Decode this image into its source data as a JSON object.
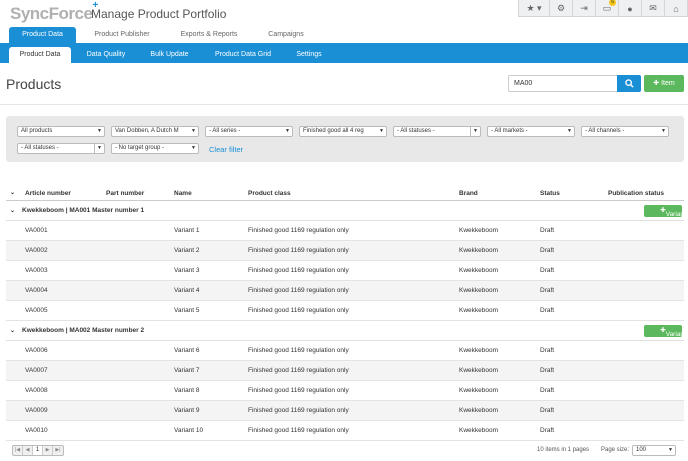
{
  "app": {
    "logo": "SyncForce",
    "logo_plus": "+",
    "title": "Manage Product Portfolio",
    "notification_count": "6"
  },
  "main_tabs": [
    {
      "label": "Product Data",
      "active": true
    },
    {
      "label": "Product Publisher"
    },
    {
      "label": "Exports & Reports"
    },
    {
      "label": "Campaigns"
    }
  ],
  "sub_tabs": [
    {
      "label": "Product Data",
      "active": true
    },
    {
      "label": "Data Quality"
    },
    {
      "label": "Bulk Update"
    },
    {
      "label": "Product Data Grid"
    },
    {
      "label": "Settings"
    }
  ],
  "page": {
    "title": "Products",
    "search_value": "MA00",
    "add_item_label": "Item"
  },
  "filters": {
    "row1": [
      "All products",
      "Van Dobben, A Dutch M",
      "- All series -",
      "Finished good all 4 reg",
      "- All statuses -",
      "- All markets -",
      "- All channels -"
    ],
    "row2": [
      "- All statuses -",
      "- No target group -"
    ],
    "clear_label": "Clear filter"
  },
  "grid": {
    "columns": [
      "Article number",
      "Part number",
      "Name",
      "Product class",
      "Brand",
      "Status",
      "Publication status"
    ],
    "add_variant_label": "Variant",
    "groups": [
      {
        "title": "Kwekkeboom | MA001 Master number 1",
        "rows": [
          {
            "article": "VA0001",
            "name": "Variant 1",
            "class": "Finished good 1169 regulation only",
            "brand": "Kwekkeboom",
            "status": "Draft"
          },
          {
            "article": "VA0002",
            "name": "Variant 2",
            "class": "Finished good 1169 regulation only",
            "brand": "Kwekkeboom",
            "status": "Draft"
          },
          {
            "article": "VA0003",
            "name": "Variant 3",
            "class": "Finished good 1169 regulation only",
            "brand": "Kwekkeboom",
            "status": "Draft"
          },
          {
            "article": "VA0004",
            "name": "Variant 4",
            "class": "Finished good 1169 regulation only",
            "brand": "Kwekkeboom",
            "status": "Draft"
          },
          {
            "article": "VA0005",
            "name": "Variant 5",
            "class": "Finished good 1169 regulation only",
            "brand": "Kwekkeboom",
            "status": "Draft"
          }
        ]
      },
      {
        "title": "Kwekkeboom | MA002 Master number 2",
        "rows": [
          {
            "article": "VA0006",
            "name": "Variant 6",
            "class": "Finished good 1169 regulation only",
            "brand": "Kwekkeboom",
            "status": "Draft"
          },
          {
            "article": "VA0007",
            "name": "Variant 7",
            "class": "Finished good 1169 regulation only",
            "brand": "Kwekkeboom",
            "status": "Draft"
          },
          {
            "article": "VA0008",
            "name": "Variant 8",
            "class": "Finished good 1169 regulation only",
            "brand": "Kwekkeboom",
            "status": "Draft"
          },
          {
            "article": "VA0009",
            "name": "Variant 9",
            "class": "Finished good 1169 regulation only",
            "brand": "Kwekkeboom",
            "status": "Draft"
          },
          {
            "article": "VA0010",
            "name": "Variant 10",
            "class": "Finished good 1169 regulation only",
            "brand": "Kwekkeboom",
            "status": "Draft"
          }
        ]
      }
    ]
  },
  "footer": {
    "current_page": "1",
    "info": "10 items in 1 pages",
    "page_size_label": "Page size:",
    "page_size": "100"
  },
  "colors": {
    "primary": "#1a8fd6",
    "success": "#5cb85c"
  }
}
